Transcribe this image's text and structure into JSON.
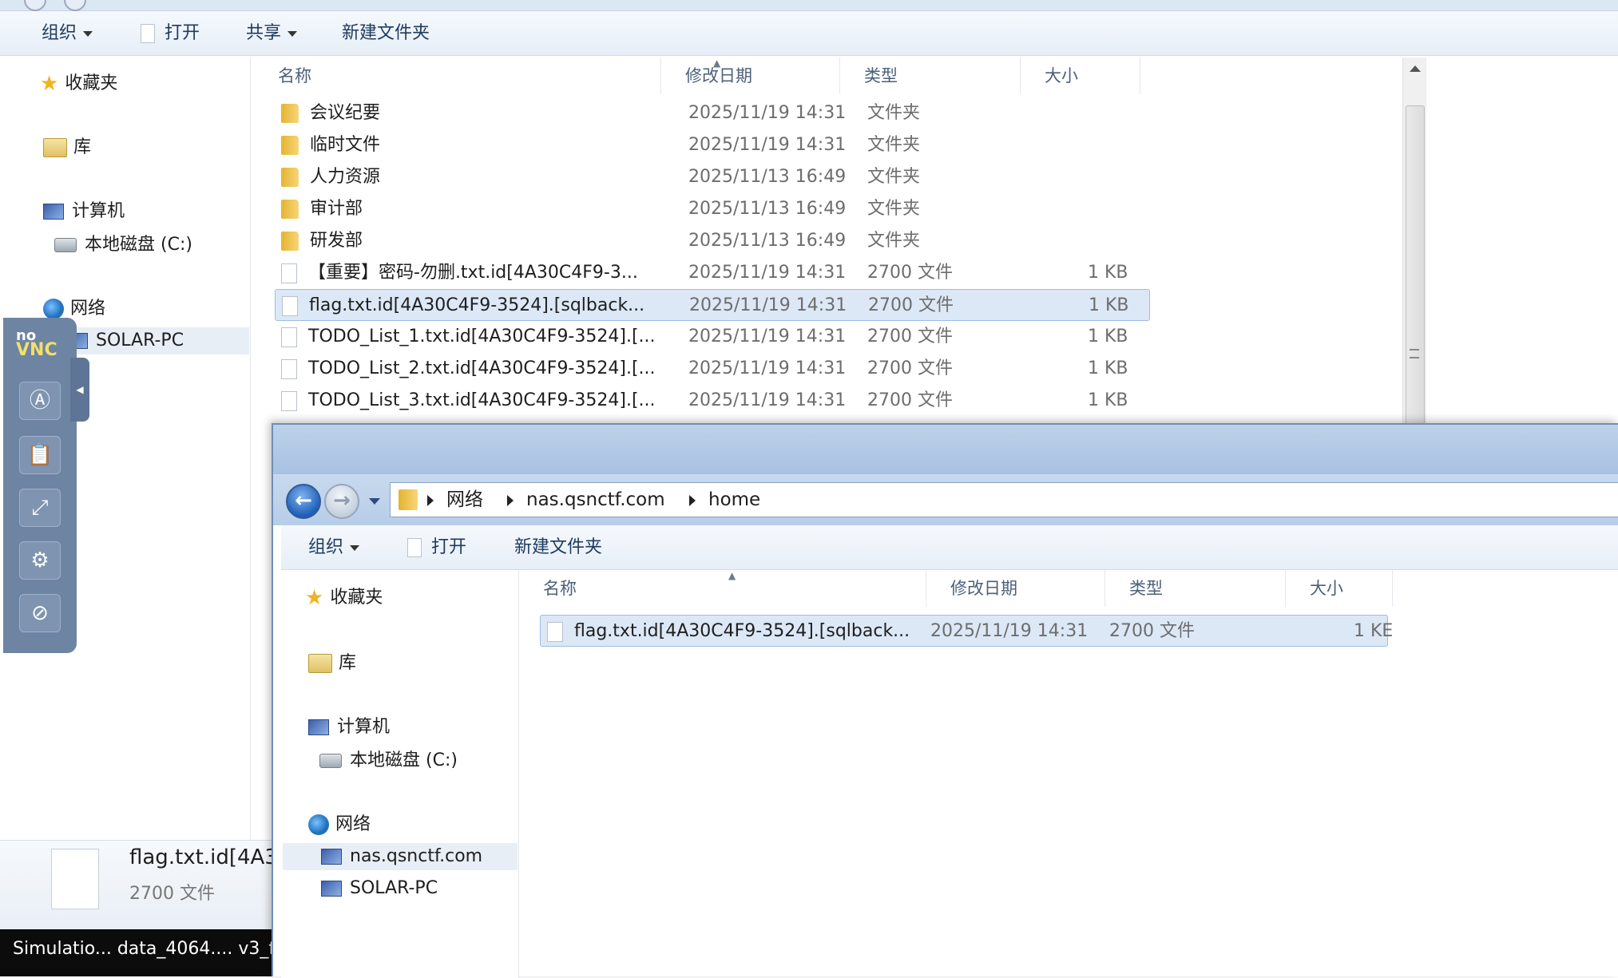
{
  "back_window": {
    "toolbar": {
      "organize": "组织",
      "open": "打开",
      "share": "共享",
      "new_folder": "新建文件夹"
    },
    "nav": {
      "favorites": "收藏夹",
      "libraries": "库",
      "computer": "计算机",
      "local_disk": "本地磁盘 (C:)",
      "network": "网络",
      "solar_pc": "SOLAR-PC"
    },
    "columns": {
      "name": "名称",
      "date": "修改日期",
      "type": "类型",
      "size": "大小"
    },
    "rows": [
      {
        "name": "会议纪要",
        "date": "2025/11/19 14:31",
        "type": "文件夹",
        "size": ""
      },
      {
        "name": "临时文件",
        "date": "2025/11/19 14:31",
        "type": "文件夹",
        "size": ""
      },
      {
        "name": "人力资源",
        "date": "2025/11/13 16:49",
        "type": "文件夹",
        "size": ""
      },
      {
        "name": "审计部",
        "date": "2025/11/13 16:49",
        "type": "文件夹",
        "size": ""
      },
      {
        "name": "研发部",
        "date": "2025/11/13 16:49",
        "type": "文件夹",
        "size": ""
      },
      {
        "name": "【重要】密码-勿删.txt.id[4A30C4F9-3...",
        "date": "2025/11/19 14:31",
        "type": "2700 文件",
        "size": "1 KB"
      },
      {
        "name": "flag.txt.id[4A30C4F9-3524].[sqlback...",
        "date": "2025/11/19 14:31",
        "type": "2700 文件",
        "size": "1 KB"
      },
      {
        "name": "TODO_List_1.txt.id[4A30C4F9-3524].[...",
        "date": "2025/11/19 14:31",
        "type": "2700 文件",
        "size": "1 KB"
      },
      {
        "name": "TODO_List_2.txt.id[4A30C4F9-3524].[...",
        "date": "2025/11/19 14:31",
        "type": "2700 文件",
        "size": "1 KB"
      },
      {
        "name": "TODO_List_3.txt.id[4A30C4F9-3524].[...",
        "date": "2025/11/19 14:31",
        "type": "2700 文件",
        "size": "1 KB"
      }
    ],
    "details": {
      "name": "flag.txt.id[4A3",
      "type": "2700 文件"
    }
  },
  "taskbar": {
    "text": "Simulatio...  data_4064....  v3_f"
  },
  "novnc": {
    "logo_top": "no",
    "logo_bottom": "VNC",
    "buttons": [
      "A",
      "clipboard",
      "fullscreen",
      "settings",
      "disconnect"
    ]
  },
  "front_window": {
    "breadcrumb": [
      "网络",
      "nas.qsnctf.com",
      "home"
    ],
    "toolbar": {
      "organize": "组织",
      "open": "打开",
      "new_folder": "新建文件夹"
    },
    "nav": {
      "favorites": "收藏夹",
      "libraries": "库",
      "computer": "计算机",
      "local_disk": "本地磁盘 (C:)",
      "network": "网络",
      "nas": "nas.qsnctf.com",
      "solar_pc": "SOLAR-PC"
    },
    "columns": {
      "name": "名称",
      "date": "修改日期",
      "type": "类型",
      "size": "大小"
    },
    "rows": [
      {
        "name": "flag.txt.id[4A30C4F9-3524].[sqlback...",
        "date": "2025/11/19 14:31",
        "type": "2700 文件",
        "size": "1 KE"
      }
    ]
  },
  "colors": {
    "selection_bg": "#dde8f6",
    "selection_border": "#9cbce6",
    "titlebar": "#bdd2ea",
    "novnc_panel": "#6e84a3"
  }
}
